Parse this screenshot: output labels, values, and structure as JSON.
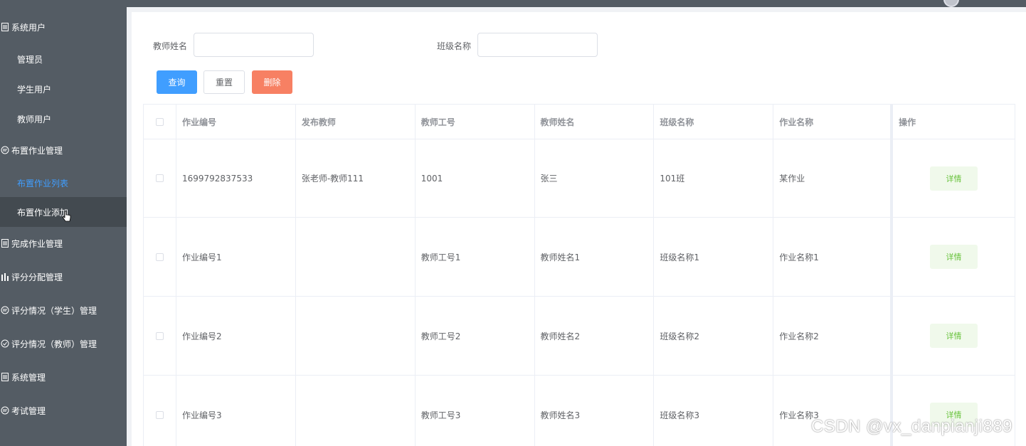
{
  "sidebar": {
    "items": [
      {
        "label": "系统用户",
        "icon": "list-icon"
      },
      {
        "label": "管理员"
      },
      {
        "label": "学生用户"
      },
      {
        "label": "教师用户"
      },
      {
        "label": "布置作业管理",
        "icon": "message-icon"
      },
      {
        "label": "布置作业列表"
      },
      {
        "label": "布置作业添加"
      },
      {
        "label": "完成作业管理",
        "icon": "list-icon"
      },
      {
        "label": "评分分配管理",
        "icon": "bar-chart-icon"
      },
      {
        "label": "评分情况（学生）管理",
        "icon": "message-icon"
      },
      {
        "label": "评分情况（教师）管理",
        "icon": "check-circle-icon"
      },
      {
        "label": "系统管理",
        "icon": "list-icon"
      },
      {
        "label": "考试管理",
        "icon": "message-icon"
      }
    ]
  },
  "search": {
    "teacher_name_label": "教师姓名",
    "teacher_name_value": "",
    "class_name_label": "班级名称",
    "class_name_value": ""
  },
  "buttons": {
    "query": "查询",
    "reset": "重置",
    "delete": "删除"
  },
  "table": {
    "headers": [
      "作业编号",
      "发布教师",
      "教师工号",
      "教师姓名",
      "班级名称",
      "作业名称",
      "操作"
    ],
    "rows": [
      [
        "1699792837533",
        "张老师-教师111",
        "1001",
        "张三",
        "101班",
        "某作业"
      ],
      [
        "作业编号1",
        "",
        "教师工号1",
        "教师姓名1",
        "班级名称1",
        "作业名称1"
      ],
      [
        "作业编号2",
        "",
        "教师工号2",
        "教师姓名2",
        "班级名称2",
        "作业名称2"
      ],
      [
        "作业编号3",
        "",
        "教师工号3",
        "教师姓名3",
        "班级名称3",
        "作业名称3"
      ]
    ],
    "action_label": "详情"
  },
  "watermark": "CSDN @vx_danpianji889",
  "colors": {
    "sidebar_bg": "#545c64",
    "active_text": "#409eff",
    "primary": "#409eff",
    "danger": "#f78063",
    "success_text": "#67c23a"
  }
}
